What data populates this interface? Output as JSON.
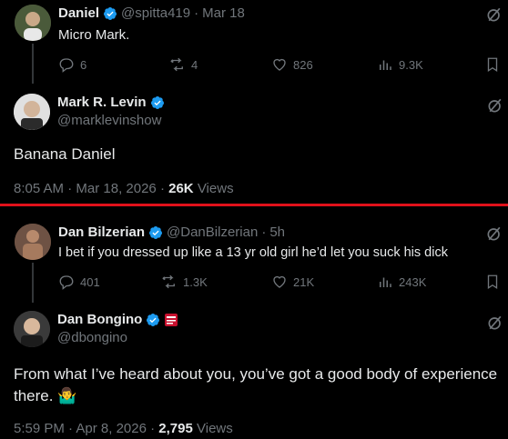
{
  "post1": {
    "name": "Daniel",
    "handle": "@spitta419",
    "dot": "·",
    "date": "Mar 18",
    "text": "Micro Mark.",
    "replies": "6",
    "reposts": "4",
    "likes": "826",
    "views": "9.3K"
  },
  "post2": {
    "name": "Mark R. Levin",
    "handle": "@marklevinshow",
    "text": "Banana Daniel",
    "time": "8:05 AM",
    "date": "Mar 18, 2026",
    "views_count": "26K",
    "views_label": "Views"
  },
  "post3": {
    "name": "Dan Bilzerian",
    "handle": "@DanBilzerian",
    "dot": "·",
    "date": "5h",
    "text": "I bet if you dressed up like a 13 yr old girl he’d let you suck his dick",
    "replies": "401",
    "reposts": "1.3K",
    "likes": "21K",
    "views": "243K"
  },
  "post4": {
    "name": "Dan Bongino",
    "handle": "@dbongino",
    "text_line1": "From what I’ve heard about you, you’ve got a good body of experience",
    "text_line2": "there.",
    "emoji": "🤷‍♂️",
    "time": "5:59 PM",
    "date": "Apr 8, 2026",
    "views_count": "2,795",
    "views_label": "Views"
  },
  "colors": {
    "background": "#000000",
    "text": "#e7e9ea",
    "muted": "#71767b",
    "verified": "#1d9bf0",
    "divider": "#e0111a"
  }
}
